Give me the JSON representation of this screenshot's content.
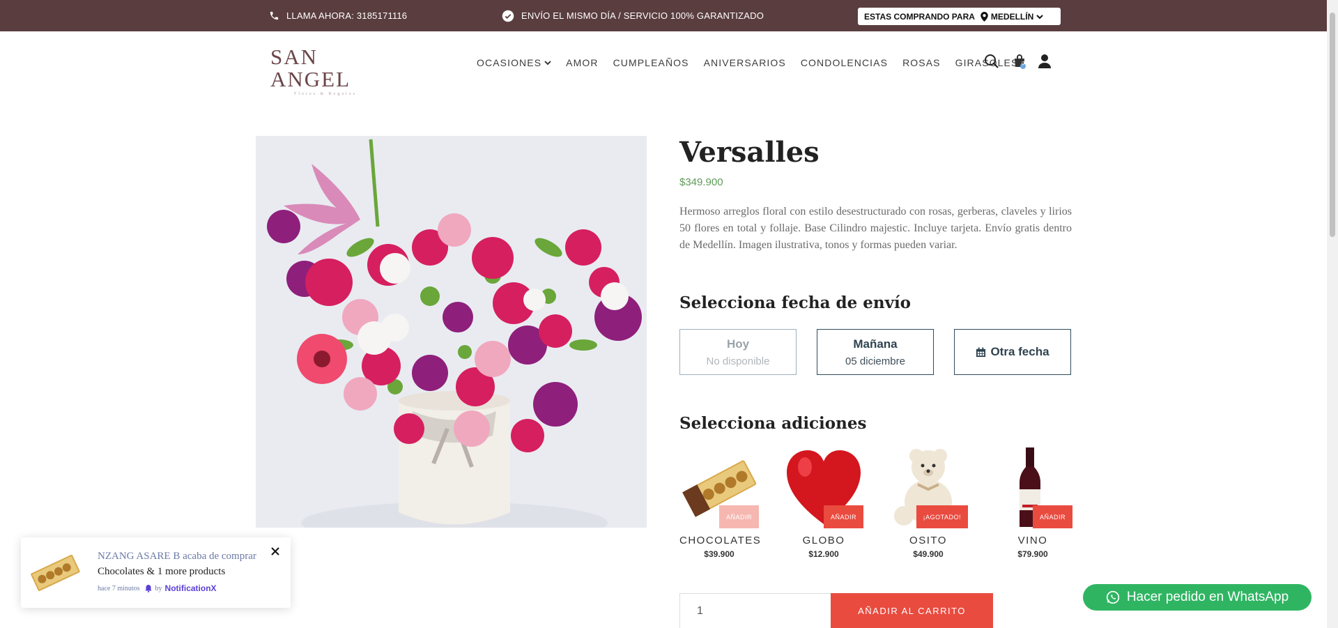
{
  "topbar": {
    "call_text": "LLAMA AHORA: 3185171116",
    "ship_text": "ENVÍO EL MISMO DÍA / SERVICIO 100% GARANTIZADO",
    "city_label": "ESTAS COMPRANDO PARA",
    "city_value": "MEDELLÍN",
    "bg_color": "#5a3d3f"
  },
  "header": {
    "logo_main": "SAN ANGEL",
    "logo_sub": "Flores & Regalos",
    "nav": [
      {
        "label": "OCASIONES",
        "dropdown": true
      },
      {
        "label": "AMOR"
      },
      {
        "label": "CUMPLEAÑOS"
      },
      {
        "label": "ANIVERSARIOS"
      },
      {
        "label": "CONDOLENCIAS"
      },
      {
        "label": "ROSAS"
      },
      {
        "label": "GIRASOLES"
      }
    ],
    "icons": [
      "search-icon",
      "cart-icon",
      "user-icon"
    ],
    "cart_count": "0"
  },
  "product": {
    "title": "Versalles",
    "price": "$349.900",
    "description": "Hermoso arreglos floral con estilo desestructurado con rosas, gerberas, claveles y lirios 50 flores en total y follaje. Base Cilindro majestic. Incluye tarjeta. Envío gratis dentro de Medellín. Imagen ilustrativa, tonos y formas pueden variar."
  },
  "shipping": {
    "title": "Selecciona fecha de envío",
    "today": {
      "label": "Hoy",
      "sub": "No disponible"
    },
    "tomorrow": {
      "label": "Mañana",
      "sub": "05 diciembre"
    },
    "other": {
      "label": "Otra fecha"
    }
  },
  "addons": {
    "title": "Selecciona adiciones",
    "items": [
      {
        "name": "CHOCOLATES",
        "price": "$39.900",
        "badge": "AÑADIR"
      },
      {
        "name": "GLOBO",
        "price": "$12.900",
        "badge": "AÑADIR"
      },
      {
        "name": "OSITO",
        "price": "$49.900",
        "badge": "¡AGOTADO!"
      },
      {
        "name": "VINO",
        "price": "$79.900",
        "badge": "AÑADIR"
      }
    ]
  },
  "cart": {
    "quantity": "1",
    "add_label": "AÑADIR AL CARRITO"
  },
  "whatsapp": {
    "label": "Hacer pedido en WhatsApp"
  },
  "notification": {
    "line1": "NZANG ASARE B acaba de comprar",
    "line2": "Chocolates & 1 more products",
    "time": "hace 7 minutos",
    "by": "by",
    "brand": "NotificationX"
  },
  "colors": {
    "accent_red": "#e94b3f",
    "price_green": "#5f9a58",
    "whatsapp_green": "#2fb562",
    "date_border": "#2e4a5a"
  }
}
